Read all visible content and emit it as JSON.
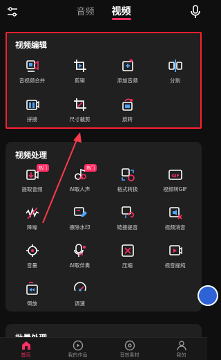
{
  "header": {
    "tabs": [
      {
        "label": "音频",
        "active": false
      },
      {
        "label": "视频",
        "active": true
      }
    ],
    "left_icon": "settings-sliders-icon",
    "right_icon": "microphone-icon"
  },
  "video_edit": {
    "title": "视频编辑",
    "tools": [
      {
        "label": "音视频合并",
        "icon": "merge-av-icon"
      },
      {
        "label": "剪辑",
        "icon": "crop-play-icon"
      },
      {
        "label": "添加音频",
        "icon": "add-audio-icon"
      },
      {
        "label": "分割",
        "icon": "split-icon"
      },
      {
        "label": "拼接",
        "icon": "splice-icon"
      },
      {
        "label": "尺寸裁剪",
        "icon": "size-crop-icon"
      },
      {
        "label": "旋转",
        "icon": "rotate-icon"
      }
    ]
  },
  "video_process": {
    "title": "视频处理",
    "tools": [
      {
        "label": "提取音频",
        "icon": "extract-audio-icon",
        "badge": "热门"
      },
      {
        "label": "AI取人声",
        "icon": "ai-vocal-icon",
        "badge": "热门",
        "ai": "AI"
      },
      {
        "label": "格式转换",
        "icon": "format-convert-icon"
      },
      {
        "label": "视频转GIF",
        "icon": "gif-icon"
      },
      {
        "label": "降噪",
        "icon": "denoise-icon"
      },
      {
        "label": "擦除水印",
        "icon": "erase-watermark-icon"
      },
      {
        "label": "链接提音",
        "icon": "link-audio-icon"
      },
      {
        "label": "视频消音",
        "icon": "mute-video-icon"
      },
      {
        "label": "音量",
        "icon": "volume-icon"
      },
      {
        "label": "AI取伴奏",
        "icon": "ai-accompaniment-icon",
        "ai": "AI"
      },
      {
        "label": "压缩",
        "icon": "compress-icon"
      },
      {
        "label": "视音提纯",
        "icon": "purify-icon"
      },
      {
        "label": "倒放",
        "icon": "reverse-icon"
      },
      {
        "label": "调速",
        "icon": "speed-icon"
      }
    ]
  },
  "batch": {
    "title": "批量处理"
  },
  "bottom_nav": [
    {
      "label": "首页",
      "icon": "home-icon",
      "active": true
    },
    {
      "label": "我的作品",
      "icon": "play-circle-icon",
      "active": false
    },
    {
      "label": "音效素材",
      "icon": "music-disc-icon",
      "active": false
    },
    {
      "label": "我的",
      "icon": "profile-icon",
      "active": false
    }
  ],
  "colors": {
    "accent": "#ff2e63",
    "highlight": "#ff2030",
    "icon_blue": "#4aa3ff",
    "background": "#0f0f0f",
    "card": "#202020"
  }
}
